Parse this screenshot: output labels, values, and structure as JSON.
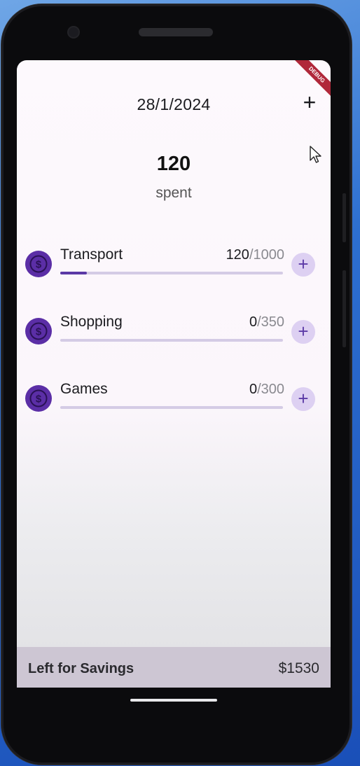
{
  "header": {
    "date": "28/1/2024",
    "add_label": "+",
    "debug_banner": "DEBUG"
  },
  "summary": {
    "total": "120",
    "label": "spent"
  },
  "categories": [
    {
      "name": "Transport",
      "spent": "120",
      "limit": "/1000",
      "progress": 0.12,
      "add_label": "+"
    },
    {
      "name": "Shopping",
      "spent": "0",
      "limit": "/350",
      "progress": 0,
      "add_label": "+"
    },
    {
      "name": "Games",
      "spent": "0",
      "limit": "/300",
      "progress": 0,
      "add_label": "+"
    }
  ],
  "footer": {
    "label": "Left for Savings",
    "value": "$1530"
  },
  "colors": {
    "accent": "#5b3aa6",
    "icon_bg": "#5b2ea6",
    "add_bg": "#ddd0f2",
    "track": "#d4cbe5",
    "footer_bg": "#cdc6d3"
  },
  "icons": {
    "category": "dollar-coin-icon",
    "add": "plus-icon",
    "pointer": "mouse-cursor-icon"
  }
}
